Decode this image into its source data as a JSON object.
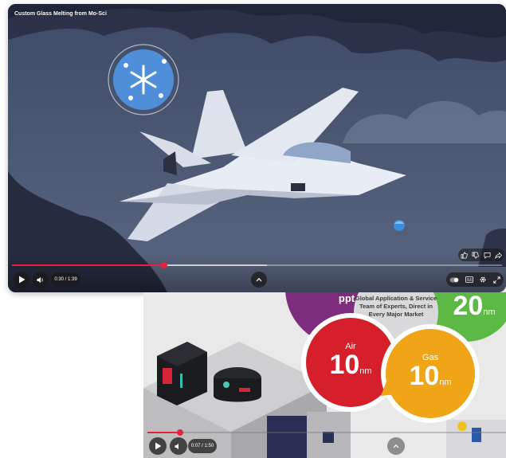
{
  "player1": {
    "title": "Custom Glass Melting from Mo-Sci",
    "time": "0:30 / 1:39",
    "progress": 0.31,
    "buffered": 0.52,
    "icons": {
      "play": "play-icon",
      "volume": "volume-icon",
      "up": "chevron-up-icon",
      "like": "thumbs-up-icon",
      "dislike": "thumbs-down-icon",
      "comment": "comment-icon",
      "share": "share-icon",
      "toggle": "toggle-icon",
      "captions": "captions-icon",
      "settings": "gear-icon",
      "fullscreen": "fullscreen-icon"
    }
  },
  "player2": {
    "time": "0:07 / 1:50",
    "progress": 0.09,
    "partial_stat": "ppt",
    "center_label": "Global Application & Service Team of Experts, Direct in Every Major Market",
    "bubbles": [
      {
        "label": "Air",
        "value": "10",
        "unit": "nm",
        "color": "#d5202c"
      },
      {
        "label": "Gas",
        "value": "10",
        "unit": "nm",
        "color": "#f0a418"
      },
      {
        "label": "",
        "value": "20",
        "unit": "nm",
        "color": "#5cb946"
      }
    ],
    "icons": {
      "play": "play-icon",
      "volume": "volume-icon",
      "up": "chevron-up-icon"
    }
  }
}
